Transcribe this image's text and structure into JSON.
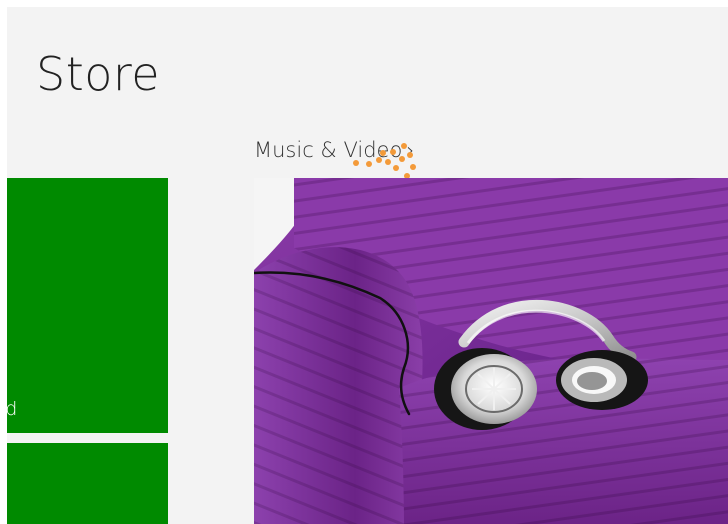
{
  "header": {
    "title": "Store"
  },
  "tiles": {
    "featured_label": "id"
  },
  "section": {
    "label": "Music & Video",
    "chevron": "›"
  },
  "colors": {
    "background": "#f3f3f3",
    "tile_green": "#008a00",
    "loading_dots": "#f39a39",
    "hero_purple": "#7b2fa0"
  },
  "icons": {
    "loading": "loading-spinner-icon",
    "chevron": "chevron-right-icon"
  }
}
